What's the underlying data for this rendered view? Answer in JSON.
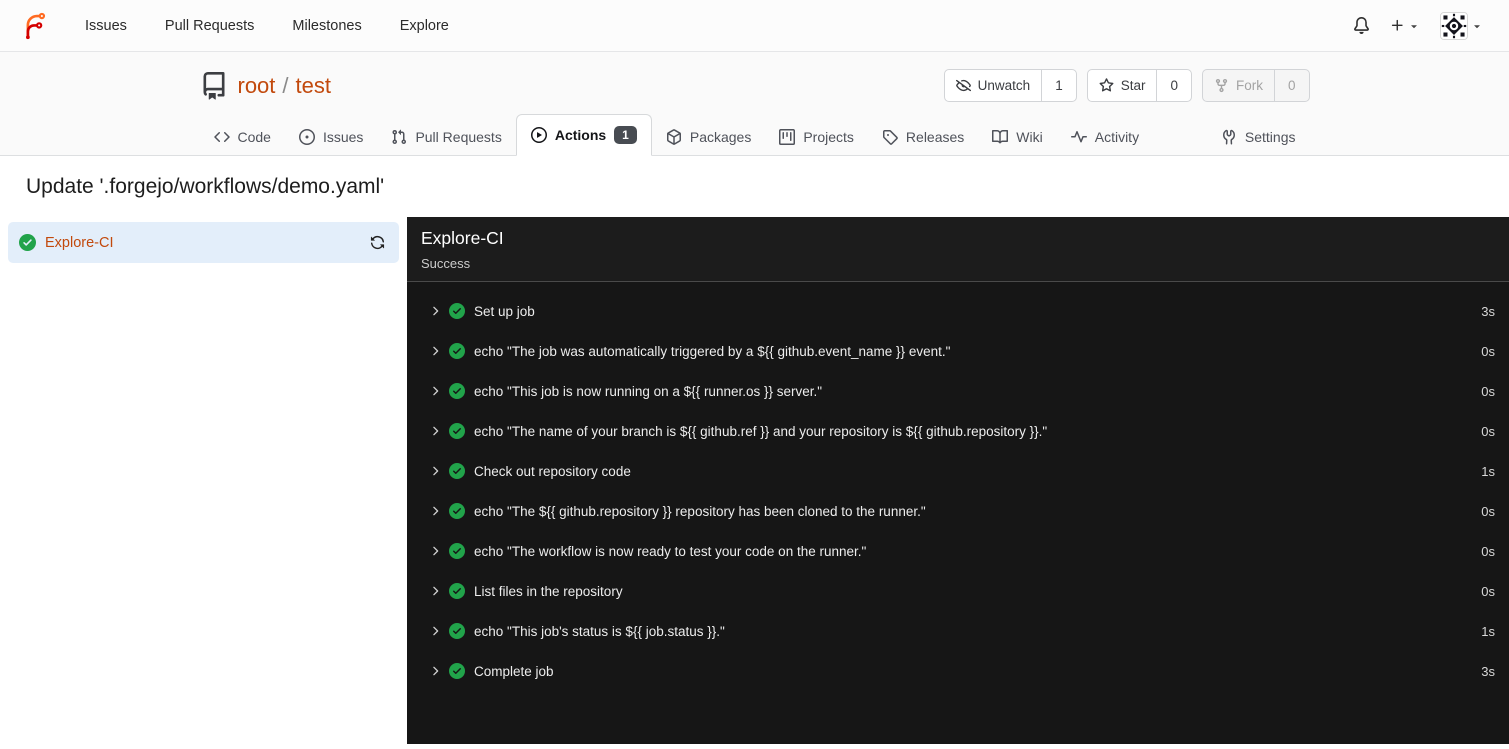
{
  "colors": {
    "link_orange": "#c2490c",
    "logo_orange": "#ff6b22",
    "logo_red": "#d40000",
    "success_green": "#21a34a",
    "console_bg": "#171717",
    "selected_job_bg": "#e3eefa",
    "tab_badge_bg": "#484c52"
  },
  "navbar": {
    "items": [
      {
        "label": "Issues"
      },
      {
        "label": "Pull Requests"
      },
      {
        "label": "Milestones"
      },
      {
        "label": "Explore"
      }
    ]
  },
  "repo": {
    "owner": "root",
    "separator": "/",
    "name": "test"
  },
  "repo_buttons": {
    "watch": {
      "label": "Unwatch",
      "count": "1"
    },
    "star": {
      "label": "Star",
      "count": "0"
    },
    "fork": {
      "label": "Fork",
      "count": "0"
    }
  },
  "tabs": [
    {
      "label": "Code"
    },
    {
      "label": "Issues"
    },
    {
      "label": "Pull Requests"
    },
    {
      "label": "Actions",
      "badge": "1",
      "active": true
    },
    {
      "label": "Packages"
    },
    {
      "label": "Projects"
    },
    {
      "label": "Releases"
    },
    {
      "label": "Wiki"
    },
    {
      "label": "Activity"
    },
    {
      "label": "Settings"
    }
  ],
  "page_title": "Update '.forgejo/workflows/demo.yaml'",
  "sidebar": {
    "job": {
      "name": "Explore-CI"
    }
  },
  "run_panel": {
    "title": "Explore-CI",
    "status": "Success",
    "steps": [
      {
        "name": "Set up job",
        "duration": "3s"
      },
      {
        "name": "echo \"The job was automatically triggered by a ${{ github.event_name }} event.\"",
        "duration": "0s"
      },
      {
        "name": "echo \"This job is now running on a ${{ runner.os }} server.\"",
        "duration": "0s"
      },
      {
        "name": "echo \"The name of your branch is ${{ github.ref }} and your repository is ${{ github.repository }}.\"",
        "duration": "0s"
      },
      {
        "name": "Check out repository code",
        "duration": "1s"
      },
      {
        "name": "echo \"The ${{ github.repository }} repository has been cloned to the runner.\"",
        "duration": "0s"
      },
      {
        "name": "echo \"The workflow is now ready to test your code on the runner.\"",
        "duration": "0s"
      },
      {
        "name": "List files in the repository",
        "duration": "0s"
      },
      {
        "name": "echo \"This job's status is ${{ job.status }}.\"",
        "duration": "1s"
      },
      {
        "name": "Complete job",
        "duration": "3s"
      }
    ]
  }
}
